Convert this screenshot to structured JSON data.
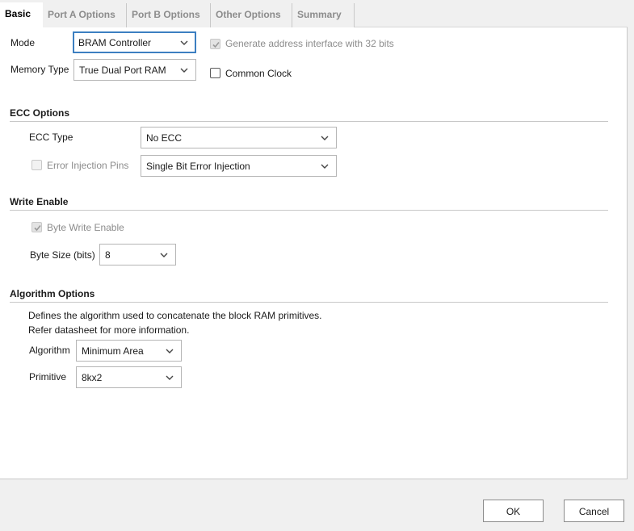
{
  "tabs": [
    {
      "label": "Basic",
      "active": true
    },
    {
      "label": "Port A Options",
      "active": false
    },
    {
      "label": "Port B Options",
      "active": false
    },
    {
      "label": "Other Options",
      "active": false
    },
    {
      "label": "Summary",
      "active": false
    }
  ],
  "basic": {
    "mode_label": "Mode",
    "mode_value": "BRAM Controller",
    "memory_type_label": "Memory Type",
    "memory_type_value": "True Dual Port RAM",
    "gen_address_label": "Generate address interface with 32 bits",
    "gen_address_checked": true,
    "common_clock_label": "Common Clock",
    "common_clock_checked": false
  },
  "ecc": {
    "section_title": "ECC Options",
    "ecc_type_label": "ECC Type",
    "ecc_type_value": "No ECC",
    "error_injection_label": "Error Injection Pins",
    "error_injection_value": "Single Bit Error Injection"
  },
  "write_enable": {
    "section_title": "Write Enable",
    "byte_write_label": "Byte Write Enable",
    "byte_write_checked": true,
    "byte_size_label": "Byte Size (bits)",
    "byte_size_value": "8"
  },
  "algorithm": {
    "section_title": "Algorithm Options",
    "description_line1": "Defines the algorithm used to concatenate the block RAM primitives.",
    "description_line2": "Refer datasheet for more information.",
    "algorithm_label": "Algorithm",
    "algorithm_value": "Minimum Area",
    "primitive_label": "Primitive",
    "primitive_value": "8kx2"
  },
  "footer": {
    "ok_label": "OK",
    "cancel_label": "Cancel"
  },
  "icons": {
    "dropdown": "chevron-down-icon",
    "check": "checkmark-icon"
  },
  "colors": {
    "focus_border": "#3c7fc1",
    "disabled_text": "#8c8c8c"
  }
}
